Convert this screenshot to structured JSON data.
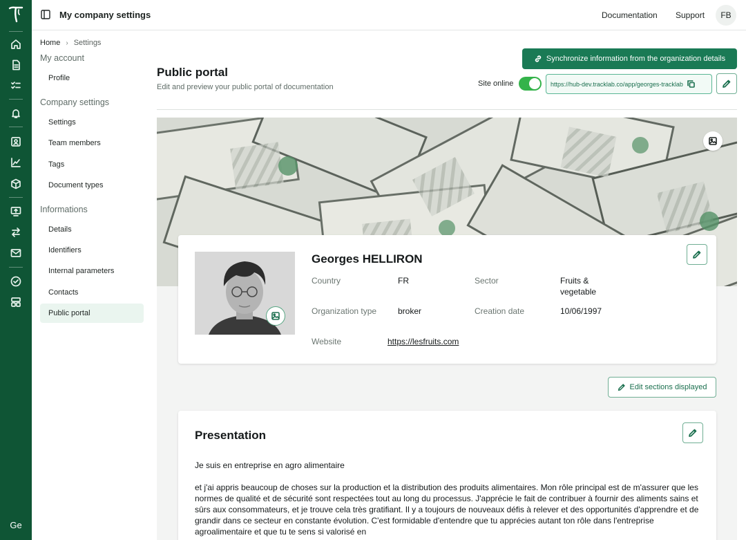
{
  "app": {
    "title": "My company settings",
    "workspace_initials": "Ge"
  },
  "topbar": {
    "documentation": "Documentation",
    "support": "Support",
    "user_initials": "FB"
  },
  "breadcrumb": {
    "home": "Home",
    "current": "Settings"
  },
  "sidebar": {
    "groups": [
      {
        "title": "My account",
        "items": [
          {
            "label": "Profile"
          }
        ]
      },
      {
        "title": "Company settings",
        "items": [
          {
            "label": "Settings"
          },
          {
            "label": "Team members"
          },
          {
            "label": "Tags"
          },
          {
            "label": "Document types"
          }
        ]
      },
      {
        "title": "Informations",
        "items": [
          {
            "label": "Details"
          },
          {
            "label": "Identifiers"
          },
          {
            "label": "Internal parameters"
          },
          {
            "label": "Contacts"
          },
          {
            "label": "Public portal"
          }
        ]
      }
    ],
    "active": "Public portal"
  },
  "rail_icons": [
    "home-icon",
    "document-icon",
    "checklist-icon",
    "bell-icon",
    "contact-card-icon",
    "chart-icon",
    "package-icon",
    "monitor-upload-icon",
    "transfer-icon",
    "mail-icon",
    "check-circle-icon",
    "dashboard-icon"
  ],
  "page": {
    "title": "Public portal",
    "subtitle": "Edit and preview your public portal of documentation",
    "sync_button": "Synchronize information from the organization details",
    "site_online_label": "Site online",
    "site_online": true,
    "url": "https://hub-dev.tracklab.co/app/georges-tracklab"
  },
  "organization": {
    "name": "Georges HELLIRON",
    "fields": {
      "country_label": "Country",
      "country": "FR",
      "sector_label": "Sector",
      "sector": "Fruits & vegetable",
      "org_type_label": "Organization type",
      "org_type": "broker",
      "creation_label": "Creation date",
      "creation": "10/06/1997",
      "website_label": "Website",
      "website": "https://lesfruits.com"
    }
  },
  "edit_sections_label": "Edit sections displayed",
  "presentation": {
    "title": "Presentation",
    "line1": "Je suis en entreprise en agro alimentaire",
    "body": "et j'ai appris beaucoup de choses sur la production et la distribution des produits alimentaires. Mon rôle principal est de m'assurer que les normes de qualité et de sécurité sont respectées tout au long du processus. J'apprécie le fait de contribuer à fournir des aliments sains et sûrs aux consommateurs, et je trouve cela très gratifiant. Il y a toujours de nouveaux défis à relever et des opportunités d'apprendre et de grandir dans ce secteur en constante évolution. C'est formidable d'entendre que tu apprécies autant ton rôle dans l'entreprise agroalimentaire et que tu te sens si valorisé en"
  },
  "colors": {
    "rail": "#0f5535",
    "accent": "#1a7a55",
    "toggle_on": "#34b34a"
  }
}
